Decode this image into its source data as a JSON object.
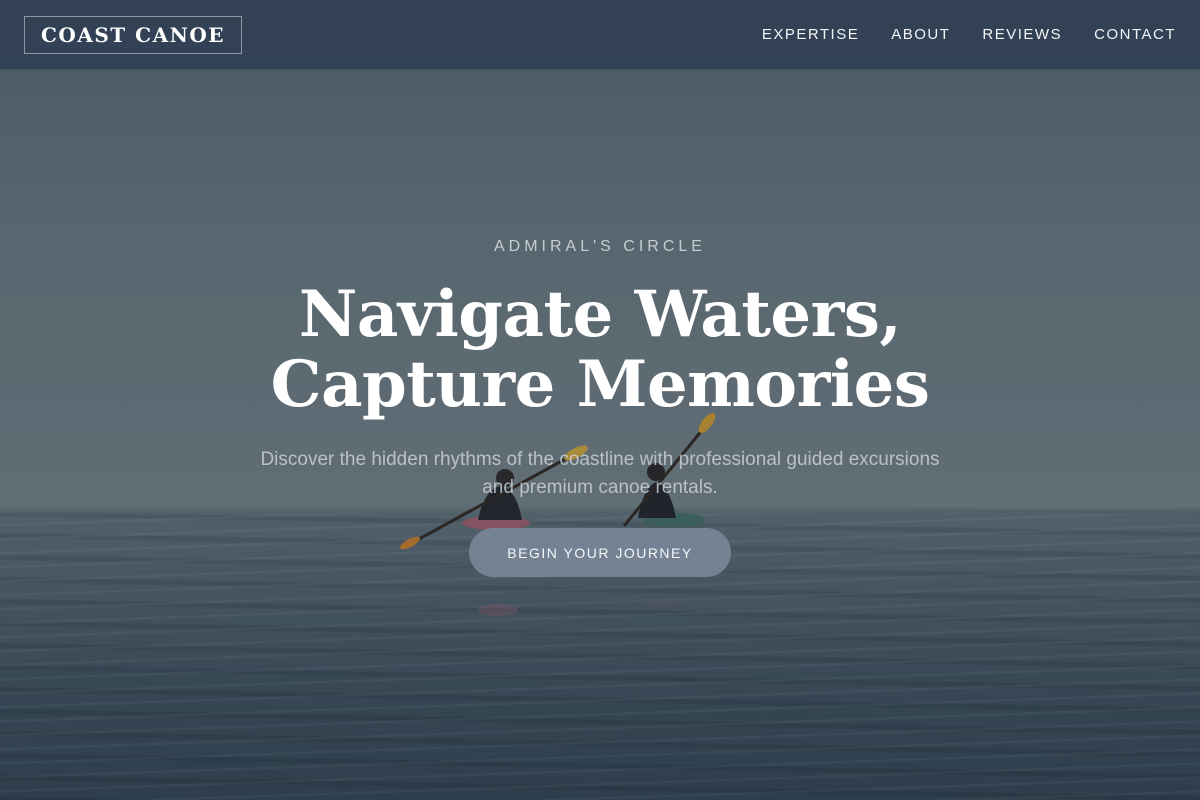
{
  "header": {
    "logo": "COAST CANOE",
    "nav": [
      {
        "label": "EXPERTISE"
      },
      {
        "label": "ABOUT"
      },
      {
        "label": "REVIEWS"
      },
      {
        "label": "CONTACT"
      }
    ]
  },
  "hero": {
    "eyebrow": "ADMIRAL'S CIRCLE",
    "headline_line1": "Navigate Waters,",
    "headline_line2": "Capture Memories",
    "subtitle": "Discover the hidden rhythms of the coastline with professional guided excursions and premium canoe rentals.",
    "cta_label": "BEGIN YOUR JOURNEY"
  },
  "colors": {
    "header_bg": "#2d3c50",
    "cta_bg": "#788698",
    "water": "#3a4c5a",
    "sky": "#60717a"
  }
}
